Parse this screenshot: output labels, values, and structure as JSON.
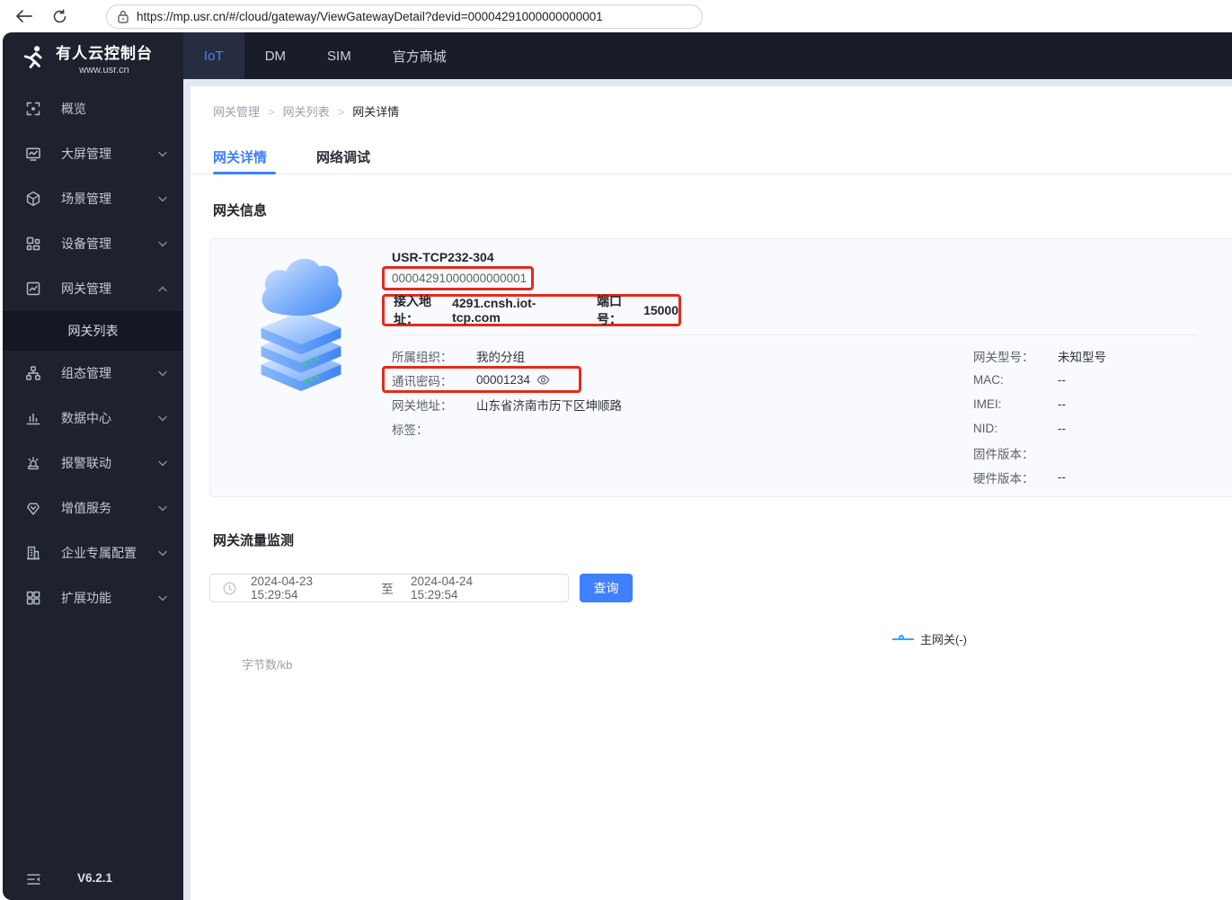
{
  "browser": {
    "url": "https://mp.usr.cn/#/cloud/gateway/ViewGatewayDetail?devid=00004291000000000001"
  },
  "brand": {
    "title": "有人云控制台",
    "subtitle": "www.usr.cn"
  },
  "topnav": {
    "tabs": [
      {
        "label": "IoT"
      },
      {
        "label": "DM"
      },
      {
        "label": "SIM"
      },
      {
        "label": "官方商城"
      }
    ]
  },
  "sidebar": {
    "items": [
      {
        "label": "概览"
      },
      {
        "label": "大屏管理"
      },
      {
        "label": "场景管理"
      },
      {
        "label": "设备管理"
      },
      {
        "label": "网关管理"
      },
      {
        "label": "组态管理"
      },
      {
        "label": "数据中心"
      },
      {
        "label": "报警联动"
      },
      {
        "label": "增值服务"
      },
      {
        "label": "企业专属配置"
      },
      {
        "label": "扩展功能"
      }
    ],
    "submenu_item": "网关列表",
    "version": "V6.2.1"
  },
  "breadcrumb": {
    "items": [
      "网关管理",
      "网关列表",
      "网关详情"
    ],
    "separator": ">"
  },
  "page_tabs": {
    "detail": "网关详情",
    "debug": "网络调试"
  },
  "gateway_info": {
    "section_title": "网关信息",
    "device_name": "USR-TCP232-304",
    "device_id": "00004291000000000001",
    "access_address_label": "接入地址：",
    "access_address": "4291.cnsh.iot-tcp.com",
    "port_label": "端口号：",
    "port": "15000",
    "left_rows": [
      {
        "label": "所属组织：",
        "value": "我的分组"
      },
      {
        "label": "通讯密码：",
        "value": "00001234"
      },
      {
        "label": "网关地址：",
        "value": "山东省济南市历下区坤顺路"
      },
      {
        "label": "标签：",
        "value": ""
      }
    ],
    "right_rows": [
      {
        "label": "网关型号：",
        "value": "未知型号"
      },
      {
        "label": "MAC:",
        "value": "--"
      },
      {
        "label": "IMEI:",
        "value": "--"
      },
      {
        "label": "NID:",
        "value": "--"
      },
      {
        "label": "固件版本：",
        "value": ""
      },
      {
        "label": "硬件版本：",
        "value": "--"
      }
    ]
  },
  "traffic": {
    "section_title": "网关流量监测",
    "date_start": "2024-04-23 15:29:54",
    "range_separator": "至",
    "date_end": "2024-04-24 15:29:54",
    "query_label": "查询",
    "y_axis_label": "字节数/kb",
    "legend_label": "主网关(-)"
  },
  "colors": {
    "accent_blue": "#4080ff",
    "active_tab_blue": "#3d7eff",
    "legend_blue": "#3aa1ff",
    "annotation_red": "#e42a1c",
    "sidebar_bg": "#1d222e",
    "topnav_bg": "#181d29"
  }
}
